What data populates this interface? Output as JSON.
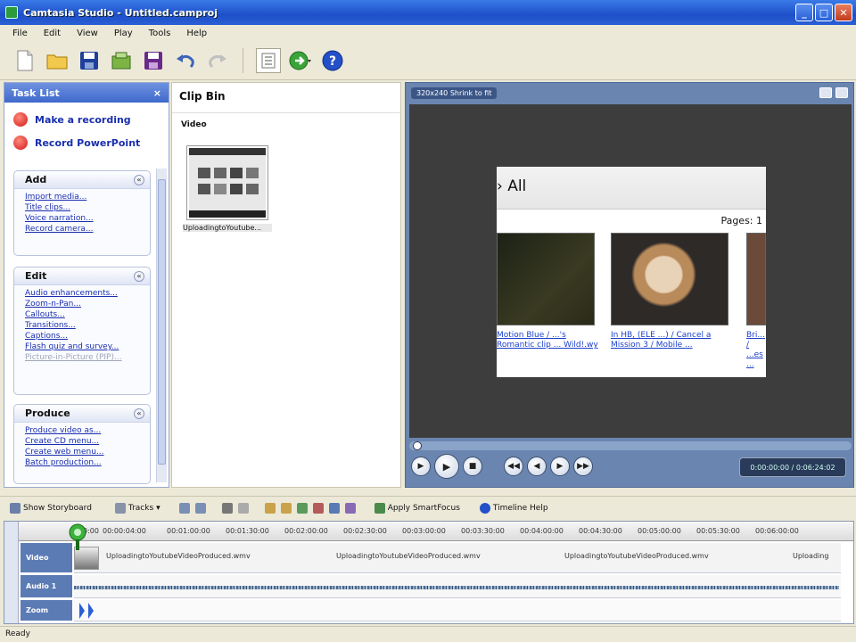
{
  "window": {
    "title": "Camtasia Studio - Untitled.camproj",
    "min": "_",
    "max": "□",
    "close": "✕"
  },
  "menu": [
    "File",
    "Edit",
    "View",
    "Play",
    "Tools",
    "Help"
  ],
  "tasklist": {
    "title": "Task List",
    "close": "×",
    "record": [
      "Make a recording",
      "Record PowerPoint"
    ],
    "groups": [
      {
        "name": "Add",
        "items": [
          "Import media...",
          "Title clips...",
          "Voice narration...",
          "Record camera..."
        ]
      },
      {
        "name": "Edit",
        "items": [
          "Audio enhancements...",
          "Zoom-n-Pan...",
          "Callouts...",
          "Transitions...",
          "Captions...",
          "Flash quiz and survey...",
          "Picture-in-Picture (PIP)..."
        ]
      },
      {
        "name": "Produce",
        "items": [
          "Produce video as...",
          "Create CD menu...",
          "Create web menu...",
          "Batch production..."
        ]
      }
    ]
  },
  "clipbin": {
    "title": "Clip Bin",
    "section": "Video",
    "clip_label": "UploadingtoYoutube..."
  },
  "preview": {
    "resolution": "320x240 Shrink to fit",
    "frame": {
      "heading": "› All",
      "pages": "Pages: 1",
      "links": [
        "Motion Blue / ...'s Romantic clip ... Wild!.wy",
        "In HB, (ELE ...) / Cancel a Mission 3 / Mobile ...",
        "Bri... / ...es ..."
      ]
    },
    "time": "0:00:00:00 / 0:06:24:02",
    "controls": {
      "play": "▶",
      "play_big": "▶",
      "stop": "■",
      "rewind": "◀◀",
      "prev": "◀",
      "next": "▶",
      "forward": "▶▶"
    }
  },
  "timeline_toolbar": {
    "storyboard": "Show Storyboard",
    "tracks": "Tracks",
    "smartfocus": "Apply SmartFocus",
    "help": "Timeline Help"
  },
  "timeline": {
    "ruler": [
      "0:00",
      "00:00:04:00",
      "00:01:00:00",
      "00:01:30:00",
      "00:02:00:00",
      "00:02:30:00",
      "00:03:00:00",
      "00:03:30:00",
      "00:04:00:00",
      "00:04:30:00",
      "00:05:00:00",
      "00:05:30:00",
      "00:06:00:00"
    ],
    "tracks": {
      "video": "Video",
      "audio": "Audio 1",
      "zoom": "Zoom"
    },
    "clip_names": [
      "UploadingtoYoutubeVideoProduced.wmv",
      "UploadingtoYoutubeVideoProduced.wmv",
      "UploadingtoYoutubeVideoProduced.wmv",
      "Uploading"
    ]
  },
  "status": "Ready",
  "colors": {
    "accent": "#3e68cc",
    "record": "#d01818",
    "preview_bg": "#6a86b0"
  }
}
